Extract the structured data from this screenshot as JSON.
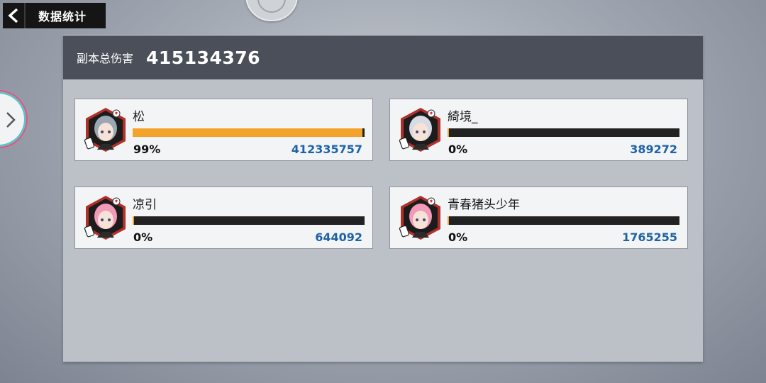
{
  "header": {
    "title": "数据统计"
  },
  "panel": {
    "total_label": "副本总伤害",
    "total_value": "415134376"
  },
  "players": [
    {
      "name": "松",
      "percent_text": "99%",
      "share": 0.99,
      "damage": "412335757",
      "avatar": "silver-hair-male-avatar",
      "hair_color": "#9aa8b4"
    },
    {
      "name": "綺境_",
      "percent_text": "0%",
      "share": 0.0,
      "damage": "389272",
      "avatar": "white-hair-male-avatar",
      "hair_color": "#d6dbe6"
    },
    {
      "name": "凉引",
      "percent_text": "0%",
      "share": 0.0,
      "damage": "644092",
      "avatar": "pink-hair-female-avatar",
      "hair_color": "#f29ab8"
    },
    {
      "name": "青春猪头少年",
      "percent_text": "0%",
      "share": 0.0,
      "damage": "1765255",
      "avatar": "pink-hair-female-avatar",
      "hair_color": "#f29ab8"
    }
  ],
  "colors": {
    "bar_fill": "#f5a22b",
    "bar_track": "#222222",
    "damage_text": "#1e63a8",
    "hex_frame": "#b2302a"
  }
}
